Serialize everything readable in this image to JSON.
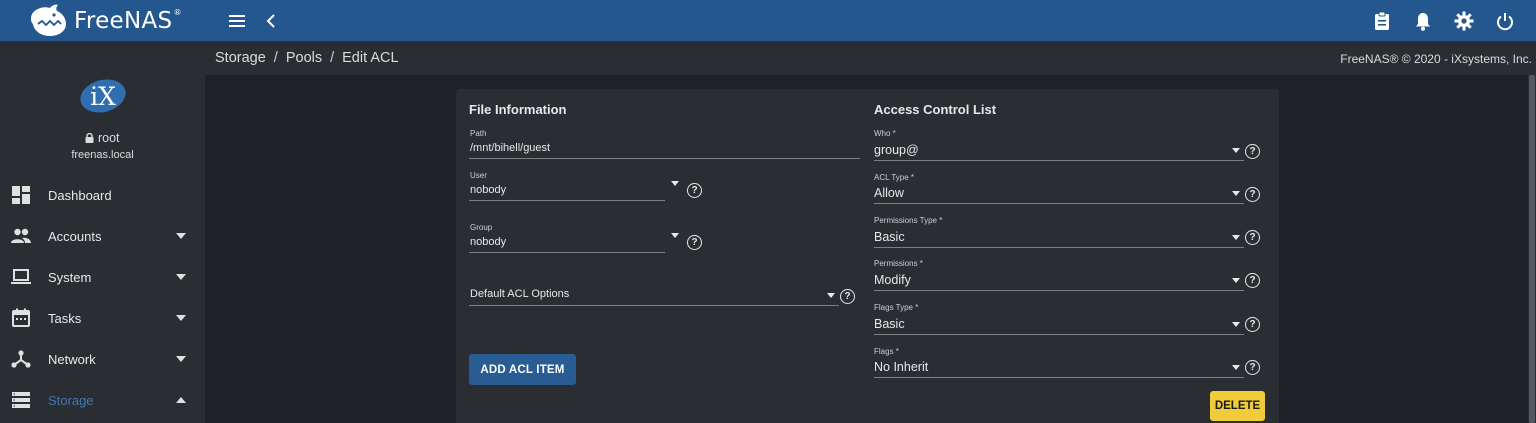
{
  "app": {
    "name": "FreeNAS",
    "trademark": "®",
    "accent_color": "#24578d",
    "sidebar_active_color": "#3f79b5"
  },
  "topbar": {
    "left_icons": [
      "menu-icon",
      "chevron-left-icon"
    ],
    "right_icons": [
      "clipboard-icon",
      "bell-icon",
      "gear-icon",
      "power-icon"
    ]
  },
  "sidebar": {
    "avatar": "iX",
    "user": "root",
    "hostname": "freenas.local",
    "items": [
      {
        "label": "Dashboard",
        "icon": "dashboard-icon",
        "has_caret": false
      },
      {
        "label": "Accounts",
        "icon": "people-icon",
        "has_caret": true
      },
      {
        "label": "System",
        "icon": "laptop-icon",
        "has_caret": true
      },
      {
        "label": "Tasks",
        "icon": "calendar-icon",
        "has_caret": true
      },
      {
        "label": "Network",
        "icon": "network-icon",
        "has_caret": true
      },
      {
        "label": "Storage",
        "icon": "storage-icon",
        "has_caret": true,
        "active": true,
        "expanded": true
      }
    ]
  },
  "breadcrumb": {
    "items": [
      "Storage",
      "Pools",
      "Edit ACL"
    ],
    "separator": "/"
  },
  "copyright": "FreeNAS® © 2020 - iXsystems, Inc.",
  "file_info": {
    "title": "File Information",
    "path": {
      "label": "Path",
      "value": "/mnt/bihell/guest"
    },
    "user": {
      "label": "User",
      "value": "nobody"
    },
    "group": {
      "label": "Group",
      "value": "nobody"
    },
    "default_acl": {
      "placeholder": "Default ACL Options"
    },
    "add_button": "ADD ACL ITEM"
  },
  "acl": {
    "title": "Access Control List",
    "who": {
      "label": "Who *",
      "value": "group@"
    },
    "acl_type": {
      "label": "ACL Type *",
      "value": "Allow"
    },
    "permissions_type": {
      "label": "Permissions Type *",
      "value": "Basic"
    },
    "permissions": {
      "label": "Permissions *",
      "value": "Modify"
    },
    "flags_type": {
      "label": "Flags Type *",
      "value": "Basic"
    },
    "flags": {
      "label": "Flags *",
      "value": "No Inherit"
    },
    "delete_button": "DELETE"
  },
  "help_glyph": "?"
}
